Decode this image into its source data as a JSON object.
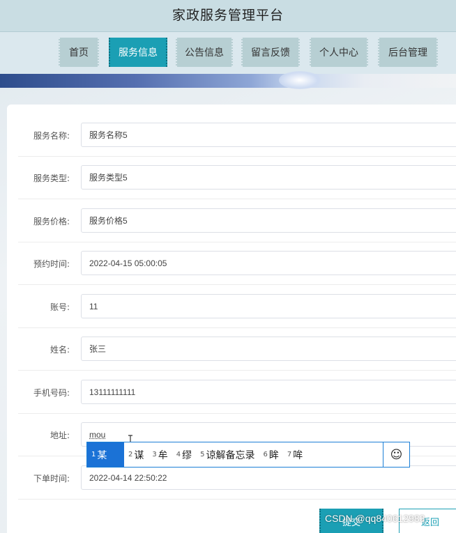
{
  "header": {
    "title": "家政服务管理平台"
  },
  "nav": [
    {
      "label": "首页",
      "active": false
    },
    {
      "label": "服务信息",
      "active": true
    },
    {
      "label": "公告信息",
      "active": false
    },
    {
      "label": "留言反馈",
      "active": false
    },
    {
      "label": "个人中心",
      "active": false
    },
    {
      "label": "后台管理",
      "active": false
    }
  ],
  "form": {
    "fields": [
      {
        "label": "服务名称:",
        "value": "服务名称5"
      },
      {
        "label": "服务类型:",
        "value": "服务类型5"
      },
      {
        "label": "服务价格:",
        "value": "服务价格5"
      },
      {
        "label": "预约时间:",
        "value": "2022-04-15 05:00:05"
      },
      {
        "label": "账号:",
        "value": "11"
      },
      {
        "label": "姓名:",
        "value": "张三"
      },
      {
        "label": "手机号码:",
        "value": "13111111111"
      },
      {
        "label": "地址:",
        "value": "mou"
      },
      {
        "label": "下单时间:",
        "value": "2022-04-14 22:50:22"
      }
    ],
    "submit_label": "提交",
    "back_label": "返回"
  },
  "ime": {
    "candidates": [
      {
        "num": "1",
        "text": "某"
      },
      {
        "num": "2",
        "text": "谋"
      },
      {
        "num": "3",
        "text": "牟"
      },
      {
        "num": "4",
        "text": "缪"
      },
      {
        "num": "5",
        "text": "谅解备忘录"
      },
      {
        "num": "6",
        "text": "眸"
      },
      {
        "num": "7",
        "text": "哞"
      }
    ],
    "emoji_icon": "smiley-icon"
  },
  "watermark": "CSDN @qq840612983",
  "colors": {
    "accent": "#1b9fb4",
    "ime_select": "#1b72d6"
  }
}
